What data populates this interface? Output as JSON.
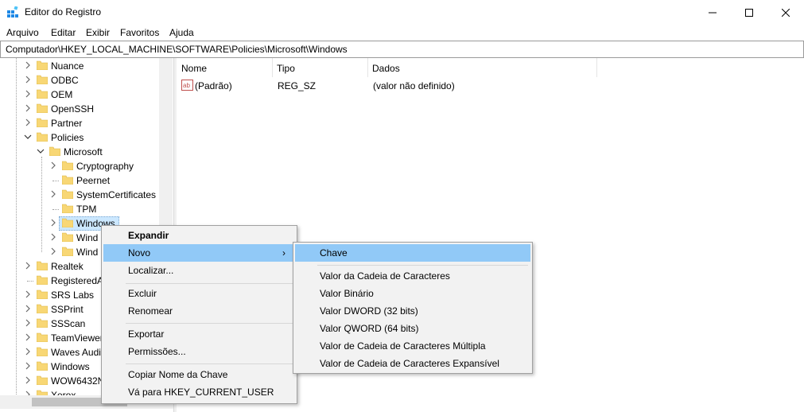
{
  "window": {
    "title": "Editor do Registro",
    "controls": {
      "minimize": "—",
      "maximize": "☐",
      "close": "✕"
    }
  },
  "menu": [
    "Arquivo",
    "Editar",
    "Exibir",
    "Favoritos",
    "Ajuda"
  ],
  "address": "Computador\\HKEY_LOCAL_MACHINE\\SOFTWARE\\Policies\\Microsoft\\Windows",
  "tree": {
    "items": [
      {
        "label": "Nuance"
      },
      {
        "label": "ODBC"
      },
      {
        "label": "OEM"
      },
      {
        "label": "OpenSSH"
      },
      {
        "label": "Partner"
      },
      {
        "label": "Policies"
      },
      {
        "label": "Microsoft"
      },
      {
        "label": "Cryptography"
      },
      {
        "label": "Peernet"
      },
      {
        "label": "SystemCertificates"
      },
      {
        "label": "TPM"
      },
      {
        "label": "Windows"
      },
      {
        "label": "Wind"
      },
      {
        "label": "Wind"
      },
      {
        "label": "Realtek"
      },
      {
        "label": "RegisteredA"
      },
      {
        "label": "SRS Labs"
      },
      {
        "label": "SSPrint"
      },
      {
        "label": "SSScan"
      },
      {
        "label": "TeamViewer"
      },
      {
        "label": "Waves Audi"
      },
      {
        "label": "Windows"
      },
      {
        "label": "WOW6432N"
      },
      {
        "label": "Xerox"
      }
    ]
  },
  "list": {
    "columns": [
      "Nome",
      "Tipo",
      "Dados"
    ],
    "rows": [
      {
        "name": "(Padrão)",
        "type": "REG_SZ",
        "data": "(valor não definido)",
        "icon": "string-value-icon"
      }
    ]
  },
  "context_menu": {
    "items": [
      "Expandir",
      "Novo",
      "Localizar...",
      "Excluir",
      "Renomear",
      "Exportar",
      "Permissões...",
      "Copiar Nome da Chave",
      "Vá para HKEY_CURRENT_USER"
    ],
    "submenu_arrow": "›"
  },
  "submenu": {
    "items": [
      "Chave",
      "Valor da Cadeia de Caracteres",
      "Valor Binário",
      "Valor DWORD (32 bits)",
      "Valor QWORD (64 bits)",
      "Valor de Cadeia de Caracteres Múltipla",
      "Valor de Cadeia de Caracteres Expansível"
    ]
  },
  "colors": {
    "highlight": "#91c9f7",
    "folder": "#f8d775",
    "selection": "#cce8ff"
  }
}
